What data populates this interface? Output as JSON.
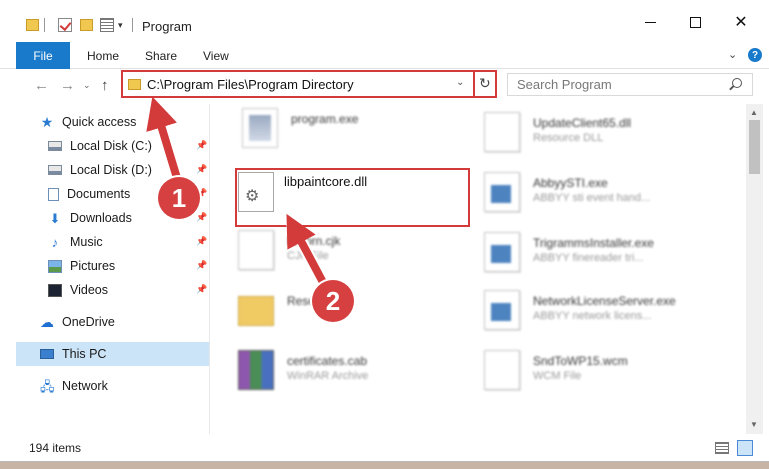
{
  "window": {
    "title": "Program"
  },
  "controls": {
    "minimize": "",
    "maximize": "",
    "close": "✕"
  },
  "ribbon": {
    "tabs": [
      "File",
      "Home",
      "Share",
      "View"
    ]
  },
  "address": {
    "path": "C:\\Program Files\\Program Directory"
  },
  "search": {
    "placeholder": "Search Program"
  },
  "sidebar": {
    "items": [
      {
        "label": "Quick access",
        "icon": "star-icon"
      },
      {
        "label": "Local Disk (C:)",
        "icon": "drive-icon"
      },
      {
        "label": "Local Disk (D:)",
        "icon": "drive-icon"
      },
      {
        "label": "Documents",
        "icon": "documents-icon"
      },
      {
        "label": "Downloads",
        "icon": "download-icon"
      },
      {
        "label": "Music",
        "icon": "music-icon"
      },
      {
        "label": "Pictures",
        "icon": "pictures-icon"
      },
      {
        "label": "Videos",
        "icon": "videos-icon"
      },
      {
        "label": "OneDrive",
        "icon": "cloud-icon"
      },
      {
        "label": "This PC",
        "icon": "computer-icon"
      },
      {
        "label": "Network",
        "icon": "network-icon"
      }
    ],
    "selected": "This PC"
  },
  "files": [
    {
      "name": "program.exe",
      "sub": ""
    },
    {
      "name": "libpaintcore.dll",
      "sub": ""
    },
    {
      "name": "libcorn.cjk",
      "sub": "CJK File"
    },
    {
      "name": "Resources",
      "sub": ""
    },
    {
      "name": "certificates.cab",
      "sub": "WinRAR Archive"
    },
    {
      "name": "UpdateClient65.dll",
      "sub": "Resource DLL"
    },
    {
      "name": "AbbyySTI.exe",
      "sub": "ABBYY sti event hand..."
    },
    {
      "name": "TrigrammsInstaller.exe",
      "sub": "ABBYY finereader tri..."
    },
    {
      "name": "NetworkLicenseServer.exe",
      "sub": "ABBYY network licens..."
    },
    {
      "name": "SndToWP15.wcm",
      "sub": "WCM File"
    }
  ],
  "status": {
    "items": "194 items"
  },
  "annotations": {
    "step1": "1",
    "step2": "2",
    "color": "#d33a3a"
  }
}
